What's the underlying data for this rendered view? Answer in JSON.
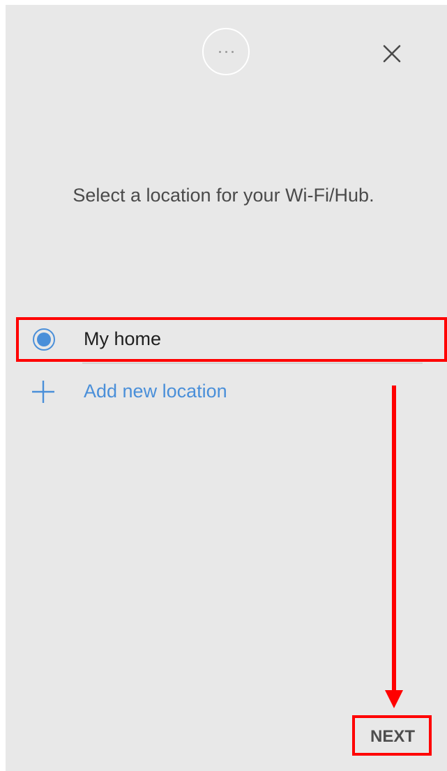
{
  "header": {
    "more_icon": "more-horizontal-icon",
    "close_icon": "close-icon"
  },
  "instruction": {
    "text": "Select a location for your Wi-Fi/Hub."
  },
  "locations": {
    "items": [
      {
        "label": "My home",
        "selected": true
      }
    ],
    "add_label": "Add new location",
    "add_icon": "plus-icon"
  },
  "footer": {
    "next_label": "NEXT"
  },
  "colors": {
    "accent": "#4a8fd9",
    "background": "#e8e8e8",
    "annotation": "#ff0000",
    "text_primary": "#1e1e1e",
    "text_secondary": "#4a4a4a"
  }
}
